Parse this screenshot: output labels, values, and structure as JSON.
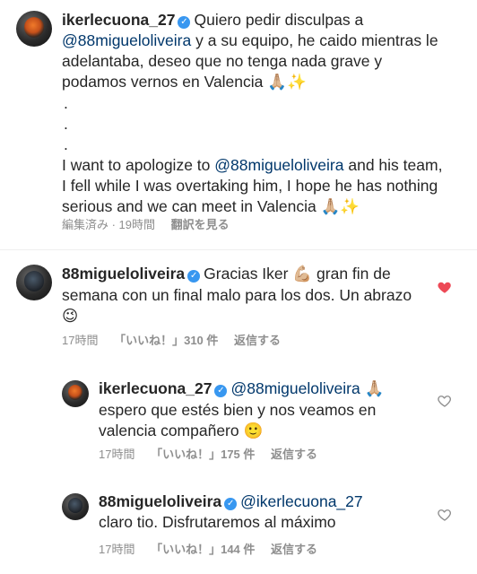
{
  "post": {
    "username": "ikerlecuona_27",
    "verified": true,
    "text_es_1": "Quiero pedir disculpas a",
    "mention_1": "@88migueloliveira",
    "text_es_2": "y a su equipo, he caido mientras le adelantaba, deseo que no tenga nada grave y podamos vernos en Valencia",
    "bullets": [
      ".",
      ".",
      "."
    ],
    "text_en_1": "I want to apologize to",
    "mention_2": "@88migueloliveira",
    "text_en_2": "and his team, I fell while I was overtaking him, I hope he has nothing serious and we can meet in Valencia",
    "emoji": "🙏🏼✨",
    "meta_edited": "編集済み · 19時間",
    "meta_translate": "翻訳を見る"
  },
  "comments": [
    {
      "username": "88migueloliveira",
      "verified": true,
      "text": "Gracias Iker",
      "emoji_1": "💪🏼",
      "text_2": "gran fin de semana con un final malo para los dos. Un abrazo",
      "emoji_2": "😉",
      "time": "17時間",
      "likes": "「いいね！」310 件",
      "reply": "返信する",
      "liked": true,
      "heart_color": "#ed4956"
    },
    {
      "username": "ikerlecuona_27",
      "verified": true,
      "mention": "@88migueloliveira",
      "emoji_1": "🙏🏼",
      "text": "espero que estés bien y nos veamos en valencia compañero",
      "emoji_2": "🙂",
      "time": "17時間",
      "likes": "「いいね！」175 件",
      "reply": "返信する",
      "liked": false
    },
    {
      "username": "88migueloliveira",
      "verified": true,
      "mention": "@ikerlecuona_27",
      "text": "claro tio. Disfrutaremos al máximo",
      "time": "17時間",
      "likes": "「いいね！」144 件",
      "reply": "返信する",
      "liked": false
    }
  ],
  "icons": {
    "verified": "verified-badge-icon",
    "heart_filled": "heart-filled-icon",
    "heart_outline": "heart-outline-icon"
  },
  "colors": {
    "mention": "#00376b",
    "meta": "#8e8e8e",
    "verified": "#3897f0",
    "heart": "#ed4956"
  }
}
